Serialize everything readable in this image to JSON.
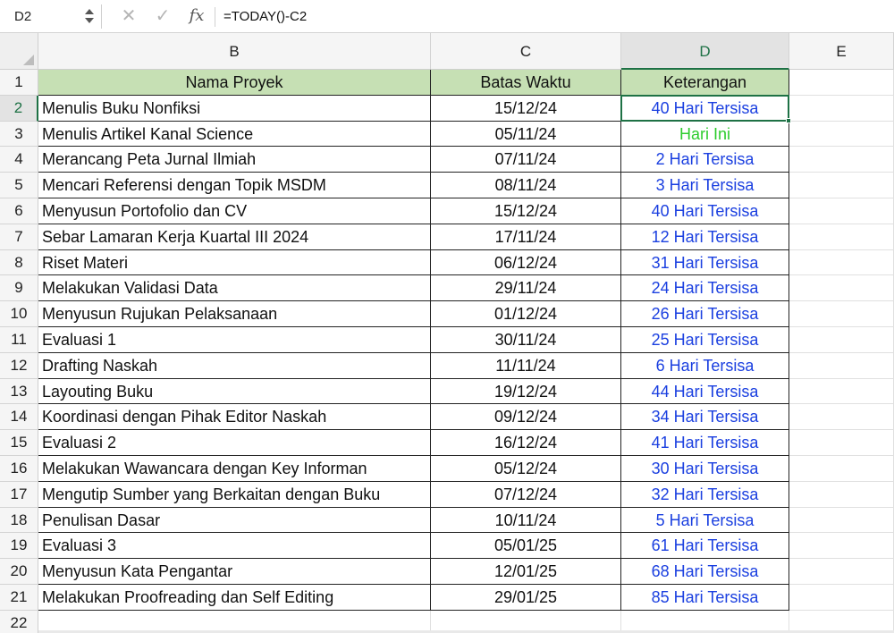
{
  "formula_bar": {
    "name_box": "D2",
    "cancel_glyph": "✕",
    "enter_glyph": "✓",
    "fx_label": "fx",
    "formula": "=TODAY()-C2"
  },
  "columns": [
    "B",
    "C",
    "D",
    "E"
  ],
  "active_column": "D",
  "row_numbers": [
    "1",
    "2",
    "3",
    "4",
    "5",
    "6",
    "7",
    "8",
    "9",
    "10",
    "11",
    "12",
    "13",
    "14",
    "15",
    "16",
    "17",
    "18",
    "19",
    "20",
    "21",
    "22"
  ],
  "active_row": "2",
  "table": {
    "headers": [
      "Nama Proyek",
      "Batas Waktu",
      "Keterangan"
    ],
    "header_color": "#c6e0b4",
    "rows": [
      {
        "name": "Menulis Buku Nonfiksi",
        "deadline": "15/12/24",
        "status": "40 Hari Tersisa",
        "status_color": "blue"
      },
      {
        "name": "Menulis Artikel Kanal Science",
        "deadline": "05/11/24",
        "status": "Hari Ini",
        "status_color": "green"
      },
      {
        "name": "Merancang Peta Jurnal Ilmiah",
        "deadline": "07/11/24",
        "status": "2 Hari Tersisa",
        "status_color": "blue"
      },
      {
        "name": "Mencari Referensi dengan Topik MSDM",
        "deadline": "08/11/24",
        "status": "3 Hari Tersisa",
        "status_color": "blue"
      },
      {
        "name": "Menyusun Portofolio dan CV",
        "deadline": "15/12/24",
        "status": "40 Hari Tersisa",
        "status_color": "blue"
      },
      {
        "name": "Sebar Lamaran Kerja Kuartal III 2024",
        "deadline": "17/11/24",
        "status": "12 Hari Tersisa",
        "status_color": "blue"
      },
      {
        "name": "Riset Materi",
        "deadline": "06/12/24",
        "status": "31 Hari Tersisa",
        "status_color": "blue"
      },
      {
        "name": "Melakukan Validasi Data",
        "deadline": "29/11/24",
        "status": "24 Hari Tersisa",
        "status_color": "blue"
      },
      {
        "name": "Menyusun Rujukan Pelaksanaan",
        "deadline": "01/12/24",
        "status": "26 Hari Tersisa",
        "status_color": "blue"
      },
      {
        "name": "Evaluasi 1",
        "deadline": "30/11/24",
        "status": "25 Hari Tersisa",
        "status_color": "blue"
      },
      {
        "name": "Drafting Naskah",
        "deadline": "11/11/24",
        "status": "6 Hari Tersisa",
        "status_color": "blue"
      },
      {
        "name": "Layouting Buku",
        "deadline": "19/12/24",
        "status": "44 Hari Tersisa",
        "status_color": "blue"
      },
      {
        "name": "Koordinasi dengan Pihak Editor Naskah",
        "deadline": "09/12/24",
        "status": "34 Hari Tersisa",
        "status_color": "blue"
      },
      {
        "name": "Evaluasi 2",
        "deadline": "16/12/24",
        "status": "41 Hari Tersisa",
        "status_color": "blue"
      },
      {
        "name": "Melakukan Wawancara dengan Key Informan",
        "deadline": "05/12/24",
        "status": "30 Hari Tersisa",
        "status_color": "blue"
      },
      {
        "name": "Mengutip Sumber yang Berkaitan dengan Buku",
        "deadline": "07/12/24",
        "status": "32 Hari Tersisa",
        "status_color": "blue"
      },
      {
        "name": "Penulisan Dasar",
        "deadline": "10/11/24",
        "status": "5 Hari Tersisa",
        "status_color": "blue"
      },
      {
        "name": "Evaluasi 3",
        "deadline": "05/01/25",
        "status": "61 Hari Tersisa",
        "status_color": "blue"
      },
      {
        "name": "Menyusun Kata Pengantar",
        "deadline": "12/01/25",
        "status": "68 Hari Tersisa",
        "status_color": "blue"
      },
      {
        "name": "Melakukan Proofreading dan Self Editing",
        "deadline": "29/01/25",
        "status": "85 Hari Tersisa",
        "status_color": "blue"
      }
    ]
  }
}
